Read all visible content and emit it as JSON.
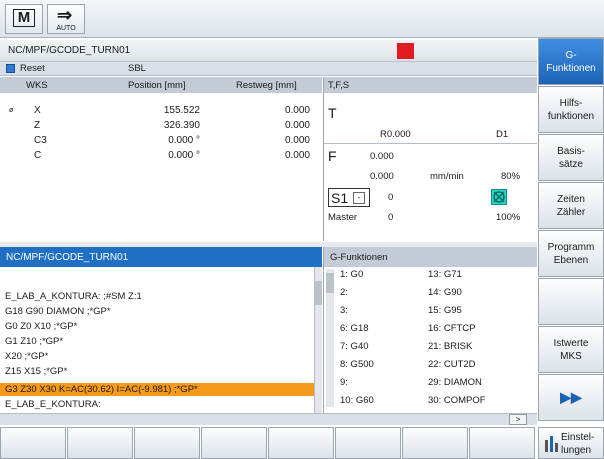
{
  "top": {
    "mode_icon": "M",
    "mode_icon_name": "machine-mode-icon",
    "auto_label": "AUTO"
  },
  "path_header": {
    "path": "NC/MPF/GCODE_TURN01"
  },
  "status": {
    "reset": "Reset",
    "sbl": "SBL"
  },
  "wks": {
    "headers": {
      "wks": "WKS",
      "position": "Position [mm]",
      "restweg": "Restweg [mm]"
    },
    "axes": [
      {
        "mark": "ø",
        "name": "X",
        "position": "155.522",
        "restweg": "0.000"
      },
      {
        "mark": "",
        "name": "Z",
        "position": "326.390",
        "restweg": "0.000"
      },
      {
        "mark": "",
        "name": "C3",
        "position": "0.000 °",
        "restweg": "0.000"
      },
      {
        "mark": "",
        "name": "C",
        "position": "0.000 °",
        "restweg": "0.000"
      }
    ]
  },
  "tfs": {
    "header": "T,F,S",
    "t_label": "T",
    "r_value": "R0.000",
    "d_value": "D1",
    "f_label": "F",
    "f_value1": "0.000",
    "f_value2": "0.000",
    "f_unit": "mm/min",
    "f_percent": "80%",
    "s_label": "S1",
    "s_dd": "-",
    "s_value": "0",
    "master_label": "Master",
    "master_value": "0",
    "master_percent": "100%"
  },
  "program": {
    "header": "NC/MPF/GCODE_TURN01",
    "lines": [
      "E_LAB_A_KONTURA: ;#SM Z:1",
      "G18 G90 DIAMON ;*GP*",
      "G0 Z0 X10 ;*GP*",
      "G1 Z10 ;*GP*",
      "X20 ;*GP*",
      "Z15 X15 ;*GP*",
      "G3 Z30 X30 K=AC(30.62) I=AC(-9.981) ;*GP*",
      "E_LAB_E_KONTURA:"
    ],
    "highlight_index": 6
  },
  "gfunktionen": {
    "header": "G-Funktionen",
    "left": [
      "1: G0",
      "2:",
      "3:",
      "6: G18",
      "7: G40",
      "8: G500",
      "9:",
      "10: G60"
    ],
    "right": [
      "13: G71",
      "14: G90",
      "15: G95",
      "16: CFTCP",
      "21: BRISK",
      "22: CUT2D",
      "29: DIAMON",
      "30: COMPOF"
    ]
  },
  "hbar_button": ">",
  "softkeys": [
    "G-\nFunktionen",
    "Hilfs-\nfunktionen",
    "Basis-\nsätze",
    "Zeiten\nZähler",
    "Programm\nEbenen",
    "",
    "Istwerte\nMKS",
    "▶▶"
  ],
  "einstellungen": "Einstel-\nlungen",
  "colors": {
    "accent": "#1f6fc4",
    "highlight": "#f59a1a",
    "alarm": "#e11b22",
    "spindle": "#27d4c4"
  }
}
